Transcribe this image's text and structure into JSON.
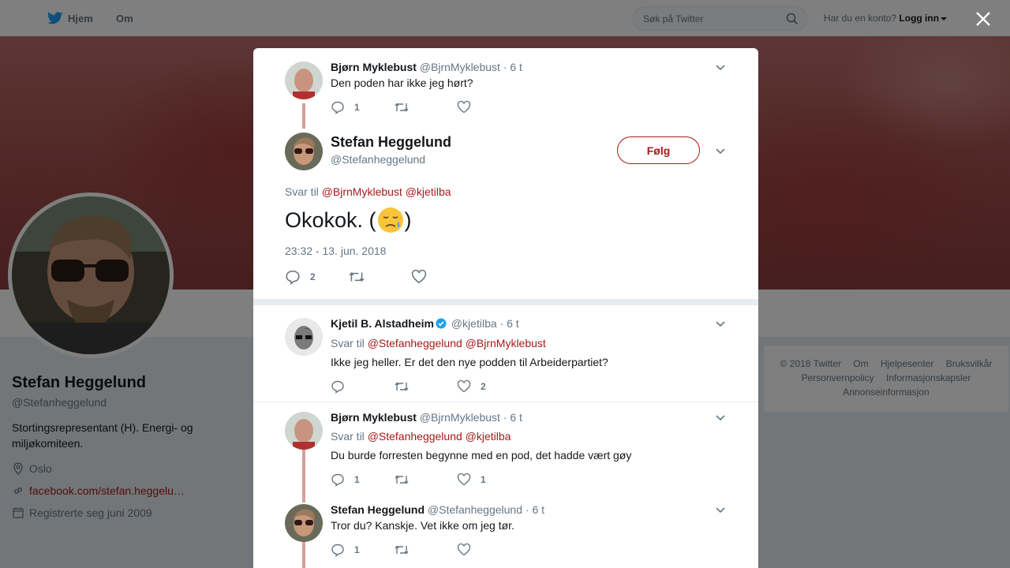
{
  "topbar": {
    "home_label": "Hjem",
    "about_label": "Om",
    "search_placeholder": "Søk på Twitter",
    "login_prompt": "Har du en konto?",
    "login_label": "Logg inn"
  },
  "profile": {
    "name": "Stefan Heggelund",
    "handle": "@Stefanheggelund",
    "bio": "Stortingsrepresentant (H). Energi- og miljøkomiteen.",
    "location": "Oslo",
    "url": "facebook.com/stefan.heggelu…",
    "joined": "Registrerte seg juni 2009"
  },
  "footer": {
    "links": [
      "© 2018 Twitter",
      "Om",
      "Hjelpesenter",
      "Bruksvilkår",
      "Personvernpolicy",
      "Informasjonskapsler",
      "Annonseinformasjon"
    ]
  },
  "modal": {
    "parent_tweet": {
      "name": "Bjørn Myklebust",
      "handle": "@BjrnMyklebust",
      "time": "· 6 t",
      "text": "Den poden har ikke jeg hørt?",
      "replies": "1",
      "retweets": "",
      "likes": ""
    },
    "main_tweet": {
      "name": "Stefan Heggelund",
      "handle": "@Stefanheggelund",
      "follow_label": "Følg",
      "reply_prefix": "Svar til",
      "mention_1": "@BjrnMyklebust",
      "mention_2": "@kjetilba",
      "text": "Okokok. (",
      "text_end": ")",
      "date": "23:32 - 13. jun. 2018",
      "replies": "2",
      "retweets": "",
      "likes": ""
    },
    "replies": [
      {
        "name": "Kjetil B. Alstadheim",
        "verified": true,
        "handle": "@kjetilba",
        "time": "· 6 t",
        "reply_prefix": "Svar til",
        "mention_1": "@Stefanheggelund",
        "mention_2": "@BjrnMyklebust",
        "text": "Ikke jeg heller. Er det den nye podden til Arbeiderpartiet?",
        "replies": "",
        "retweets": "",
        "likes": "2"
      },
      {
        "name": "Bjørn Myklebust",
        "handle": "@BjrnMyklebust",
        "time": "· 6 t",
        "reply_prefix": "Svar til",
        "mention_1": "@Stefanheggelund",
        "mention_2": "@kjetilba",
        "text": "Du burde forresten begynne med en pod, det hadde vært gøy",
        "replies": "1",
        "retweets": "",
        "likes": "1"
      },
      {
        "name": "Stefan Heggelund",
        "handle": "@Stefanheggelund",
        "time": "· 6 t",
        "text": "Tror du? Kanskje. Vet ikke om jeg tør.",
        "replies": "1",
        "retweets": "",
        "likes": ""
      }
    ]
  },
  "colors": {
    "accent": "#a61a1a",
    "twitter_blue": "#1da1f2",
    "thread_line": "#d4a19b",
    "muted_text": "#657786"
  }
}
